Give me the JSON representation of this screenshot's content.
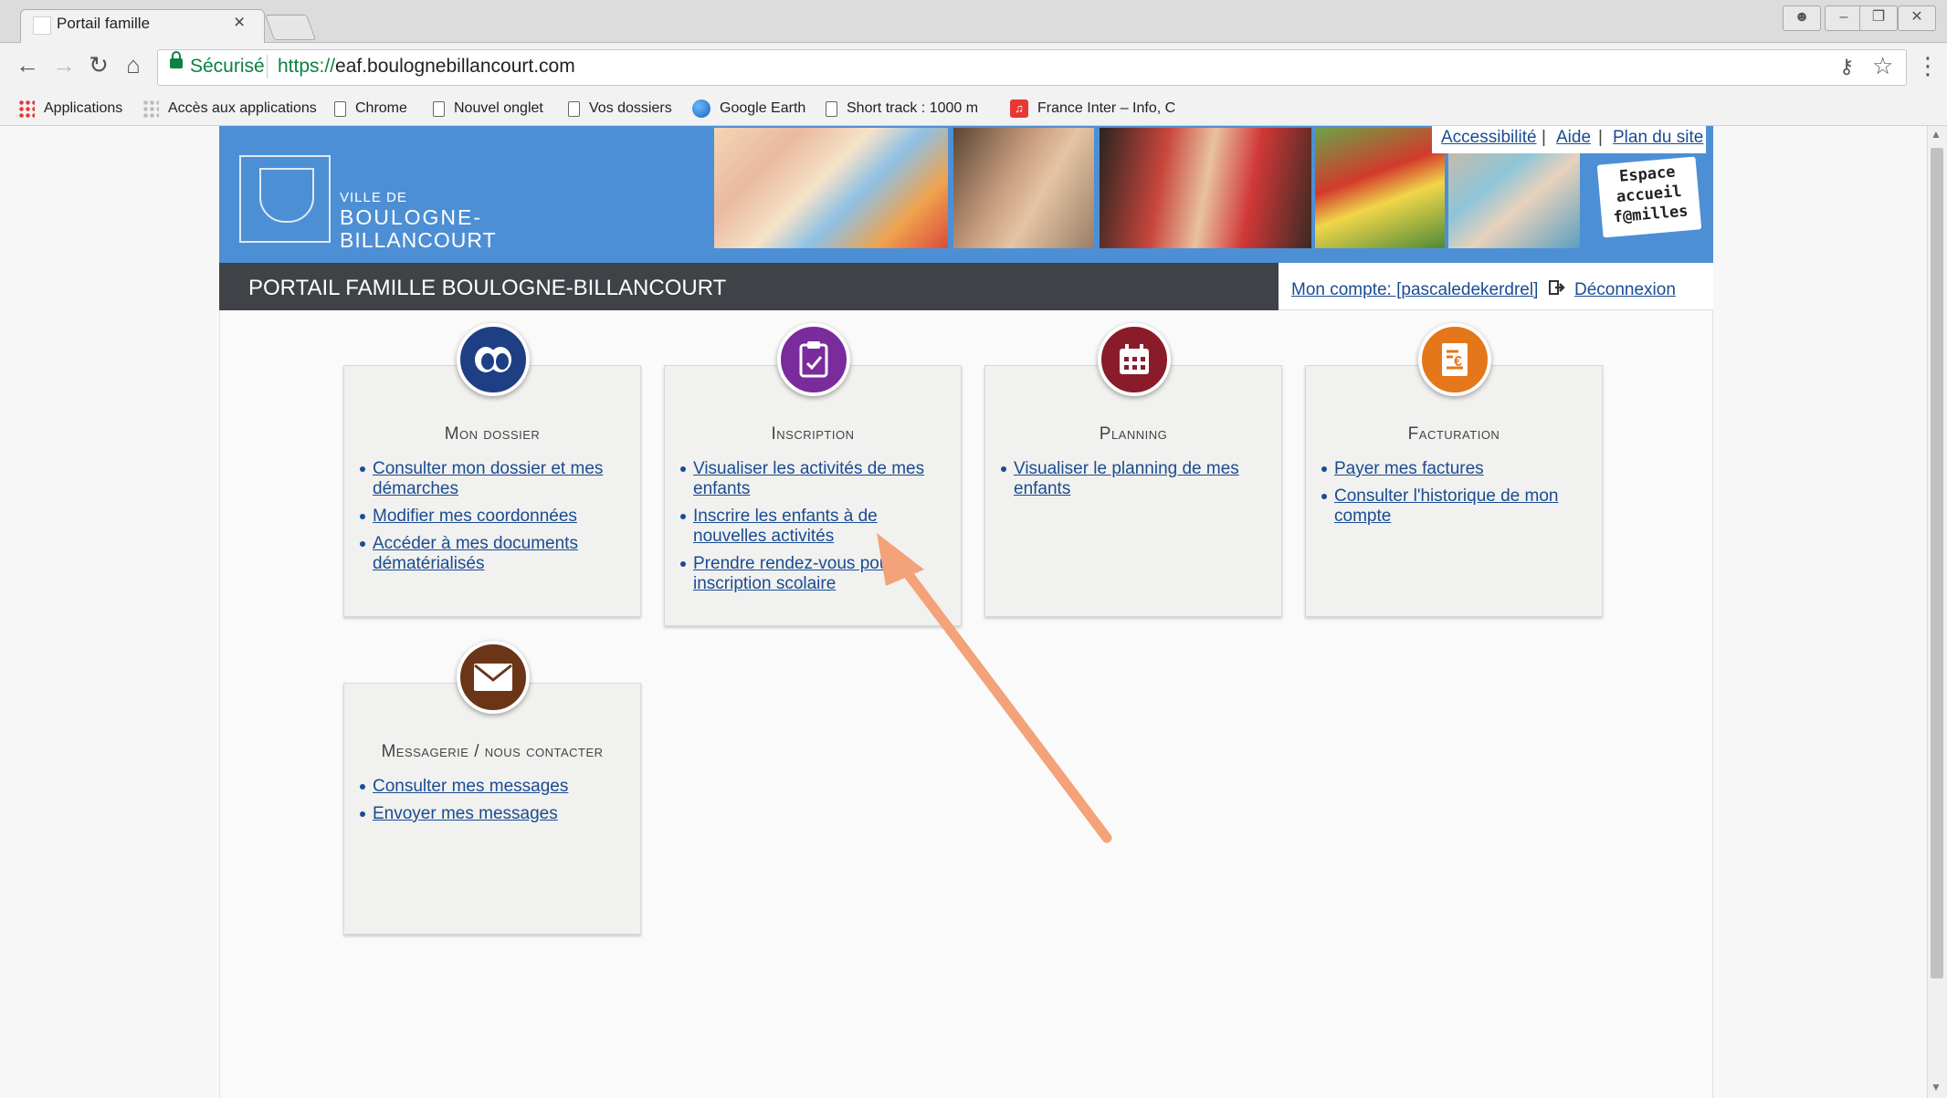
{
  "browser": {
    "tab_title": "Portail famille",
    "tab_close": "×",
    "window_controls": [
      "user",
      "minimize",
      "restore",
      "close"
    ],
    "secure_label": "Sécurisé",
    "url_protocol": "https://",
    "url_host": "eaf.boulognebillancourt.com",
    "bookmarks": [
      {
        "label": "Applications",
        "icon": "apps-grid-icon"
      },
      {
        "label": "Accès aux applications",
        "icon": "dots-icon"
      },
      {
        "label": "Chrome",
        "icon": "page-icon"
      },
      {
        "label": "Nouvel onglet",
        "icon": "page-icon"
      },
      {
        "label": "Vos dossiers",
        "icon": "page-icon"
      },
      {
        "label": "Google Earth",
        "icon": "globe-icon"
      },
      {
        "label": "Short track : 1000 m",
        "icon": "page-icon"
      },
      {
        "label": "France Inter – Info, C",
        "icon": "radio-icon"
      }
    ]
  },
  "header": {
    "logo_small": "VILLE DE",
    "logo_line1": "BOULOGNE-",
    "logo_line2": "BILLANCOURT",
    "espace_badge": [
      "Espace",
      "accueil",
      "f@milles"
    ],
    "top_links": [
      "Accessibilité",
      "Aide",
      "Plan du site"
    ],
    "top_sep": "|",
    "portal_title": "PORTAIL FAMILLE BOULOGNE-BILLANCOURT",
    "account": "Mon compte: [pascaledekerdrel]",
    "logout": "Déconnexion"
  },
  "cards": [
    {
      "title": "Mon dossier",
      "icon": "folder-eye-icon",
      "color": "#1f3f84",
      "links": [
        "Consulter mon dossier et mes démarches",
        "Modifier mes coordonnées",
        "Accéder à mes documents dématérialisés"
      ]
    },
    {
      "title": "Inscription",
      "icon": "clipboard-icon",
      "color": "#7a2b9c",
      "links": [
        "Visualiser les activités de mes enfants",
        "Inscrire les enfants à de nouvelles activités",
        "Prendre rendez-vous pour le inscription scolaire"
      ]
    },
    {
      "title": "Planning",
      "icon": "calendar-icon",
      "color": "#8a1c2a",
      "links": [
        "Visualiser le planning de mes enfants"
      ]
    },
    {
      "title": "Facturation",
      "icon": "invoice-euro-icon",
      "color": "#e3771a",
      "links": [
        "Payer mes factures",
        "Consulter l'historique de mon compte"
      ]
    },
    {
      "title": "Messagerie / nous contacter",
      "icon": "envelope-icon",
      "color": "#6b3518",
      "links": [
        "Consulter mes messages",
        "Envoyer mes messages"
      ]
    }
  ],
  "annotation": {
    "color": "#f4a27a"
  }
}
